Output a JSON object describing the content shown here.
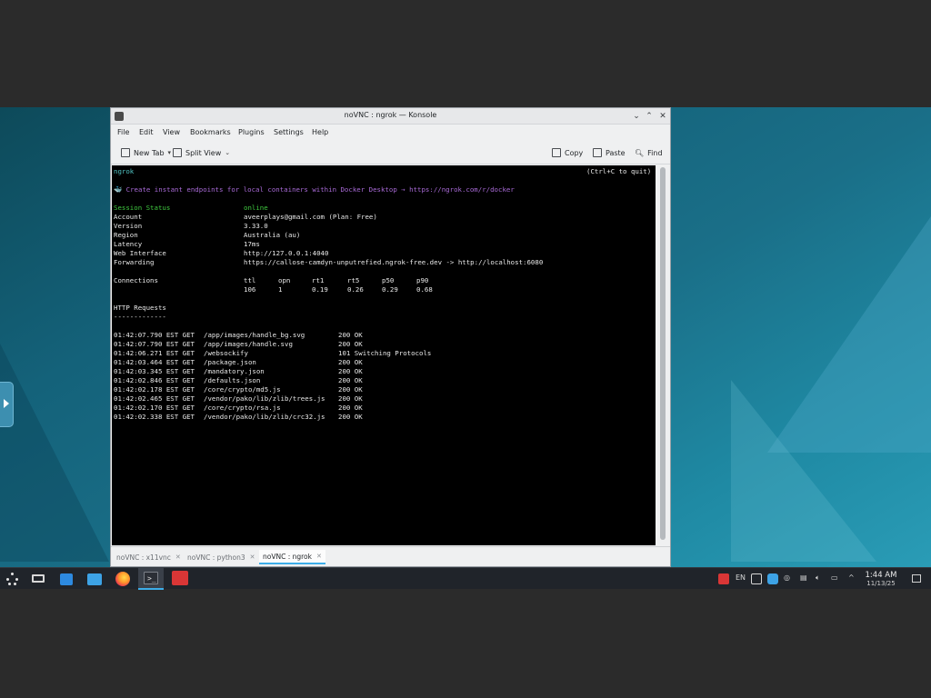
{
  "window": {
    "title": "noVNC : ngrok — Konsole",
    "controls": [
      "⌄",
      "⌃",
      "✕"
    ]
  },
  "menu": [
    "File",
    "Edit",
    "View",
    "Bookmarks",
    "Plugins",
    "Settings",
    "Help"
  ],
  "toolbar": {
    "new_tab": "New Tab",
    "split_view": "Split View",
    "copy": "Copy",
    "paste": "Paste",
    "find": "Find"
  },
  "terminal": {
    "header_left": "ngrok",
    "header_right": "(Ctrl+C to quit)",
    "promo": "🐳 Create instant endpoints for local containers within Docker Desktop → https://ngrok.com/r/docker",
    "status": [
      {
        "key": "Session Status",
        "value": "online"
      },
      {
        "key": "Account",
        "value": "aveerplays@gmail.com (Plan: Free)"
      },
      {
        "key": "Version",
        "value": "3.33.0"
      },
      {
        "key": "Region",
        "value": "Australia (au)"
      },
      {
        "key": "Latency",
        "value": "17ms"
      },
      {
        "key": "Web Interface",
        "value": "http://127.0.0.1:4040"
      },
      {
        "key": "Forwarding",
        "value": "https://callose-camdyn-unputrefied.ngrok-free.dev -> http://localhost:6080"
      }
    ],
    "connections": {
      "label": "Connections",
      "headers": [
        "ttl",
        "opn",
        "rt1",
        "rt5",
        "p50",
        "p90"
      ],
      "values": [
        "106",
        "1",
        "0.19",
        "0.26",
        "0.29",
        "0.68"
      ]
    },
    "http_title": "HTTP Requests",
    "http_rule": "-------------",
    "requests": [
      {
        "time": "01:42:07.790 EST GET",
        "path": "/app/images/handle_bg.svg",
        "status": "200 OK"
      },
      {
        "time": "01:42:07.790 EST GET",
        "path": "/app/images/handle.svg",
        "status": "200 OK"
      },
      {
        "time": "01:42:06.271 EST GET",
        "path": "/websockify",
        "status": "101 Switching Protocols"
      },
      {
        "time": "01:42:03.464 EST GET",
        "path": "/package.json",
        "status": "200 OK"
      },
      {
        "time": "01:42:03.345 EST GET",
        "path": "/mandatory.json",
        "status": "200 OK"
      },
      {
        "time": "01:42:02.846 EST GET",
        "path": "/defaults.json",
        "status": "200 OK"
      },
      {
        "time": "01:42:02.178 EST GET",
        "path": "/core/crypto/md5.js",
        "status": "200 OK"
      },
      {
        "time": "01:42:02.465 EST GET",
        "path": "/vendor/pako/lib/zlib/trees.js",
        "status": "200 OK"
      },
      {
        "time": "01:42:02.170 EST GET",
        "path": "/core/crypto/rsa.js",
        "status": "200 OK"
      },
      {
        "time": "01:42:02.338 EST GET",
        "path": "/vendor/pako/lib/zlib/crc32.js",
        "status": "200 OK"
      }
    ]
  },
  "tabs": [
    {
      "label": "noVNC : x11vnc",
      "active": false
    },
    {
      "label": "noVNC : python3",
      "active": false
    },
    {
      "label": "noVNC : ngrok",
      "active": true
    }
  ],
  "taskbar": {
    "tray_lang": "EN",
    "clock_time": "1:44 AM",
    "clock_date": "11/13/25"
  },
  "colors": {
    "accent": "#3daee9",
    "online_green": "#3fc83f",
    "promo_purple": "#a86ad6"
  }
}
